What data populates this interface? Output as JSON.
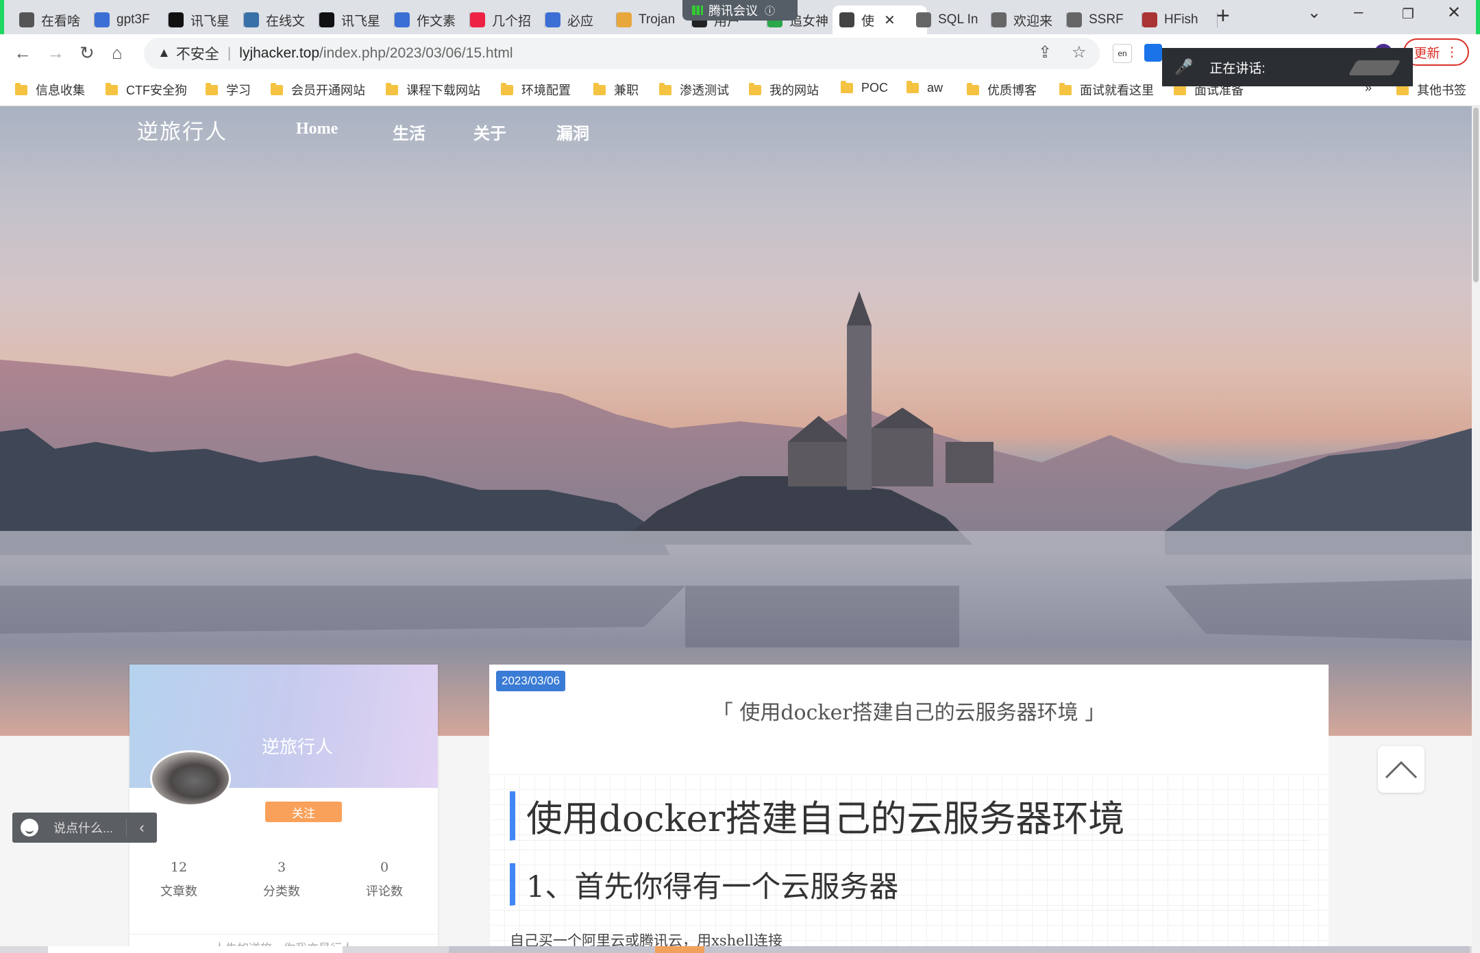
{
  "tabs": [
    {
      "label": "在看啥",
      "icon": "yuque-icon",
      "color": "#555"
    },
    {
      "label": "gpt3F",
      "icon": "search-icon",
      "color": "#3b6fd6"
    },
    {
      "label": "讯飞星",
      "icon": "notion-icon",
      "color": "#111"
    },
    {
      "label": "在线文",
      "icon": "python-icon",
      "color": "#3a70a8"
    },
    {
      "label": "讯飞星",
      "icon": "notion-icon",
      "color": "#111"
    },
    {
      "label": "作文素",
      "icon": "search-icon",
      "color": "#3b6fd6"
    },
    {
      "label": "几个招",
      "icon": "microsoft-icon",
      "color": "#e24"
    },
    {
      "label": "必应",
      "icon": "search-icon",
      "color": "#3b6fd6"
    },
    {
      "label": "Trojan",
      "icon": "chrome-icon",
      "color": "#e8a73c"
    },
    {
      "label": "用户",
      "icon": "github-icon",
      "color": "#222"
    },
    {
      "label": "追女神",
      "icon": "wechat-icon",
      "color": "#2aa84a"
    },
    {
      "label": "使",
      "icon": "page-icon",
      "color": "#444",
      "active": true
    },
    {
      "label": "SQL In",
      "icon": "globe-icon",
      "color": "#666"
    },
    {
      "label": "欢迎来",
      "icon": "globe-icon",
      "color": "#666"
    },
    {
      "label": "SSRF",
      "icon": "globe-icon",
      "color": "#666"
    },
    {
      "label": "HFish",
      "icon": "hfish-icon",
      "color": "#a33"
    }
  ],
  "meeting": {
    "label": "腾讯会议"
  },
  "address": {
    "warning": "不安全",
    "host": "lyjhacker.top",
    "path": "/index.php/2023/03/06/15.html"
  },
  "update_label": "更新",
  "speaking_label": "正在讲话:",
  "bookmarks": [
    "信息收集",
    "CTF安全狗",
    "学习",
    "会员开通网站",
    "课程下载网站",
    "环境配置",
    "兼职",
    "渗透测试",
    "我的网站",
    "POC",
    "aw",
    "优质博客",
    "面试就看这里",
    "面试准备"
  ],
  "bookmarks_more": "»",
  "bookmarks_other": "其他书签",
  "site": {
    "title": "逆旅行人",
    "nav": [
      "Home",
      "生活",
      "关于",
      "漏洞"
    ]
  },
  "profile": {
    "name": "逆旅行人",
    "follow": "关注",
    "stats": [
      {
        "num": "12",
        "label": "文章数"
      },
      {
        "num": "3",
        "label": "分类数"
      },
      {
        "num": "0",
        "label": "评论数"
      }
    ],
    "motto": "人生如逆旅，你我亦是行人"
  },
  "article": {
    "date": "2023/03/06",
    "title": "「 使用docker搭建自己的云服务器环境 」",
    "h1": "使用docker搭建自己的云服务器环境",
    "h2": "1、首先你得有一个云服务器",
    "paragraph": "自己买一个阿里云或腾讯云，用xshell连接"
  },
  "chat": {
    "placeholder": "说点什么..."
  }
}
